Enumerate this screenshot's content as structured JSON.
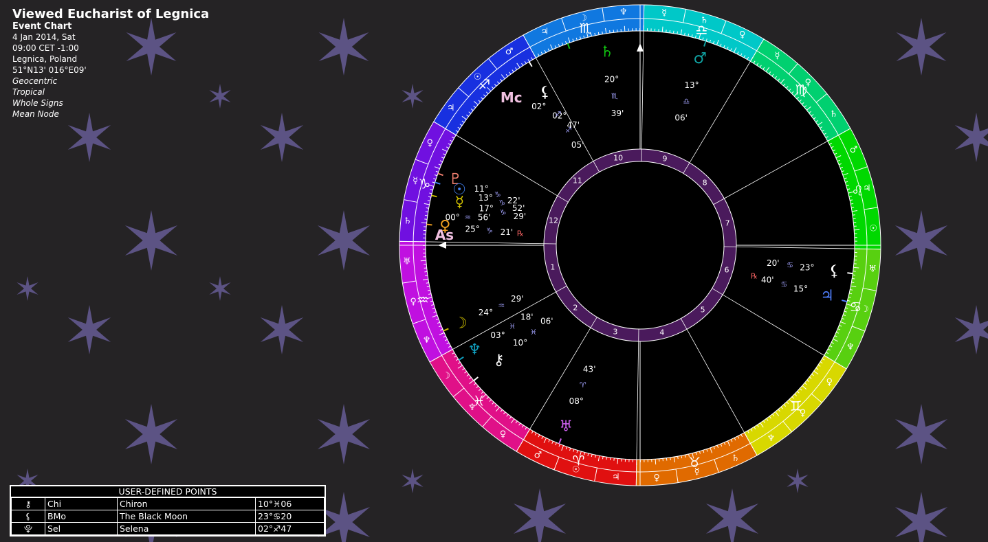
{
  "chart": {
    "title": "Viewed Eucharist of Legnica",
    "type": "Event Chart",
    "date": "4 Jan 2014, Sat",
    "time": "09:00  CET -1:00",
    "place": "Legnica, Poland",
    "coords": "51°N13' 016°E09'",
    "options": [
      "Geocentric",
      "Tropical",
      "Whole Signs",
      "Mean Node"
    ]
  },
  "signs": [
    {
      "name": "Aries",
      "glyph": "♈",
      "color": "#e01010",
      "rulers": [
        "♂",
        "☉",
        "♃"
      ]
    },
    {
      "name": "Taurus",
      "glyph": "♉",
      "color": "#e06a00",
      "rulers": [
        "♀",
        "☿",
        "♄"
      ]
    },
    {
      "name": "Gemini",
      "glyph": "♊",
      "color": "#d8d800",
      "rulers": [
        "♆",
        "♀",
        "♀"
      ]
    },
    {
      "name": "Cancer",
      "glyph": "♋",
      "color": "#58d010",
      "rulers": [
        "♆",
        "☽",
        "♅"
      ]
    },
    {
      "name": "Leo",
      "glyph": "♌",
      "color": "#00d800",
      "rulers": [
        "☉",
        "♃",
        "♂"
      ]
    },
    {
      "name": "Virgo",
      "glyph": "♍",
      "color": "#00d070",
      "rulers": [
        "♄",
        "♀",
        "☿"
      ]
    },
    {
      "name": "Libra",
      "glyph": "♎",
      "color": "#00c8c8",
      "rulers": [
        "♀",
        "♄",
        "☿"
      ]
    },
    {
      "name": "Scorpio",
      "glyph": "♏",
      "color": "#1078e0",
      "rulers": [
        "♆",
        "☽",
        "♃"
      ]
    },
    {
      "name": "Sagittarius",
      "glyph": "♐",
      "color": "#1830e0",
      "rulers": [
        "♂",
        "☉",
        "♃"
      ]
    },
    {
      "name": "Capricorn",
      "glyph": "♑",
      "color": "#7010e0",
      "rulers": [
        "♀",
        "☿",
        "♄"
      ]
    },
    {
      "name": "Aquarius",
      "glyph": "♒",
      "color": "#c010e0",
      "rulers": [
        "♅",
        "♀",
        "♆"
      ]
    },
    {
      "name": "Pisces",
      "glyph": "♓",
      "color": "#e01088",
      "rulers": [
        "☽",
        "♆",
        "♀"
      ]
    }
  ],
  "houses": [
    "1",
    "2",
    "3",
    "4",
    "5",
    "6",
    "7",
    "8",
    "9",
    "10",
    "11",
    "12"
  ],
  "angles": {
    "asc": {
      "glyph": "As",
      "deg": "00°",
      "sign": "♒",
      "min": "56'"
    },
    "mc": {
      "glyph": "Mc",
      "deg": "02°",
      "sign": "♐",
      "min": "47'"
    }
  },
  "planets": [
    {
      "name": "Saturn",
      "glyph": "♄",
      "color": "#10c010",
      "deg": "20°",
      "sign": "♏",
      "min": "39'",
      "retro": ""
    },
    {
      "name": "Mars",
      "glyph": "♂",
      "color": "#10a0a0",
      "deg": "13°",
      "sign": "♎",
      "min": "06'",
      "retro": ""
    },
    {
      "name": "Selena",
      "glyph": "⚸",
      "color": "#ffffff",
      "deg": "02°",
      "sign": "♐",
      "min": "05'",
      "retro": ""
    },
    {
      "name": "Pluto",
      "glyph": "♇",
      "color": "#f08070",
      "deg": "11°",
      "sign": "♑",
      "min": "22'",
      "retro": ""
    },
    {
      "name": "Sun",
      "glyph": "☉",
      "color": "#4080f0",
      "deg": "13°",
      "sign": "♑",
      "min": "52'",
      "retro": ""
    },
    {
      "name": "Mercury",
      "glyph": "☿",
      "color": "#d0c000",
      "deg": "17°",
      "sign": "♑",
      "min": "29'",
      "retro": ""
    },
    {
      "name": "Venus",
      "glyph": "♀",
      "color": "#f0a020",
      "deg": "25°",
      "sign": "♑",
      "min": "21'",
      "retro": "℞"
    },
    {
      "name": "Black Moon",
      "glyph": "⚸",
      "color": "#ffffff",
      "deg": "23°",
      "sign": "♋",
      "min": "20'",
      "retro": ""
    },
    {
      "name": "Jupiter",
      "glyph": "♃",
      "color": "#5080ff",
      "deg": "15°",
      "sign": "♋",
      "min": "40'",
      "retro": "℞"
    },
    {
      "name": "Moon",
      "glyph": "☽",
      "color": "#d0c000",
      "deg": "24°",
      "sign": "♒",
      "min": "29'",
      "retro": ""
    },
    {
      "name": "Neptune",
      "glyph": "♆",
      "color": "#10a0c0",
      "deg": "03°",
      "sign": "♓",
      "min": "18'",
      "retro": ""
    },
    {
      "name": "Chiron",
      "glyph": "⚷",
      "color": "#ffffff",
      "deg": "10°",
      "sign": "♓",
      "min": "06'",
      "retro": ""
    },
    {
      "name": "Uranus",
      "glyph": "♅",
      "color": "#d060f0",
      "deg": "08°",
      "sign": "♈",
      "min": "43'",
      "retro": ""
    }
  ],
  "udp": {
    "header": "USER-DEFINED POINTS",
    "rows": [
      {
        "glyph": "⚷",
        "abbr": "Chi",
        "name": "Chiron",
        "pos": "10°♓06"
      },
      {
        "glyph": "⚸",
        "abbr": "BMo",
        "name": "The Black Moon",
        "pos": "23°♋20"
      },
      {
        "glyph": "⯓",
        "abbr": "Sel",
        "name": "Selena",
        "pos": "02°♐47"
      }
    ]
  }
}
